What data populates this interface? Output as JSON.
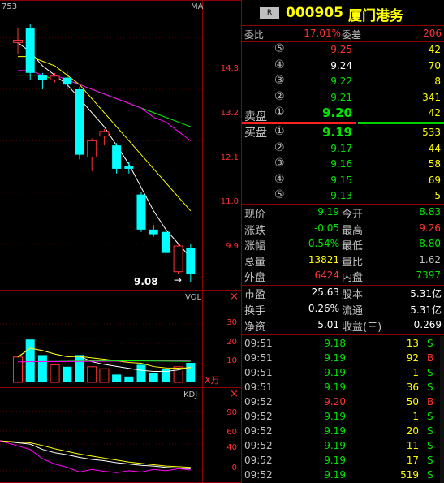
{
  "chart_panel": {
    "code_label": "753",
    "ma_label": "MA",
    "price_axis": [
      "14.3",
      "13.2",
      "12.1",
      "11.0",
      "9.9"
    ],
    "low_marker": "9.08",
    "vol_label": "VOL",
    "vol_axis": [
      "30",
      "20",
      "10"
    ],
    "vol_unit": "X万",
    "kdj_label": "KDJ",
    "kdj_axis": [
      "90",
      "60",
      "40",
      "20",
      "0"
    ]
  },
  "chart_data": {
    "type": "candlestick",
    "price_range": [
      9.0,
      14.9
    ],
    "candles": [
      {
        "o": 14.2,
        "c": 14.25,
        "h": 14.5,
        "l": 13.95,
        "color": "red"
      },
      {
        "o": 14.5,
        "c": 13.55,
        "h": 14.6,
        "l": 13.4,
        "color": "cyan"
      },
      {
        "o": 13.5,
        "c": 13.4,
        "h": 13.55,
        "l": 13.2,
        "color": "cyan"
      },
      {
        "o": 13.4,
        "c": 13.48,
        "h": 13.55,
        "l": 13.35,
        "color": "red"
      },
      {
        "o": 13.45,
        "c": 13.3,
        "h": 13.6,
        "l": 13.2,
        "color": "cyan"
      },
      {
        "o": 13.2,
        "c": 11.8,
        "h": 13.25,
        "l": 11.7,
        "color": "cyan"
      },
      {
        "o": 11.75,
        "c": 12.1,
        "h": 12.15,
        "l": 11.45,
        "color": "red"
      },
      {
        "o": 12.2,
        "c": 12.3,
        "h": 12.35,
        "l": 12.0,
        "color": "red"
      },
      {
        "o": 12.0,
        "c": 11.5,
        "h": 12.05,
        "l": 11.4,
        "color": "cyan"
      },
      {
        "o": 11.55,
        "c": 11.5,
        "h": 11.65,
        "l": 11.4,
        "color": "cyan"
      },
      {
        "o": 10.95,
        "c": 10.2,
        "h": 11.0,
        "l": 10.15,
        "color": "cyan"
      },
      {
        "o": 10.2,
        "c": 10.1,
        "h": 10.3,
        "l": 10.05,
        "color": "cyan"
      },
      {
        "o": 10.15,
        "c": 9.7,
        "h": 10.25,
        "l": 9.65,
        "color": "cyan"
      },
      {
        "o": 9.3,
        "c": 9.85,
        "h": 9.9,
        "l": 9.25,
        "color": "red"
      },
      {
        "o": 9.8,
        "c": 9.25,
        "h": 9.9,
        "l": 9.08,
        "color": "cyan"
      }
    ],
    "ma_series": [
      {
        "color": "#ffffff",
        "values": [
          14.2,
          14.0,
          13.7,
          13.5,
          13.3,
          13.0,
          12.7,
          12.4,
          12.0,
          11.6,
          11.1,
          10.6,
          10.2,
          9.9,
          9.6
        ]
      },
      {
        "color": "#ffff00",
        "values": [
          13.9,
          13.9,
          13.8,
          13.7,
          13.5,
          13.3,
          13.0,
          12.7,
          12.4,
          12.1,
          11.8,
          11.5,
          11.2,
          10.9,
          10.6
        ]
      },
      {
        "color": "#00ff00",
        "values": [
          13.5,
          13.5,
          13.5,
          13.4,
          13.4,
          13.3,
          13.2,
          13.1,
          13.0,
          12.9,
          12.8,
          12.7,
          12.6,
          12.5,
          12.4
        ]
      },
      {
        "color": "#ff00ff",
        "values": [
          13.6,
          13.6,
          13.5,
          13.5,
          13.4,
          13.3,
          13.2,
          13.1,
          13.0,
          12.9,
          12.8,
          12.6,
          12.5,
          12.3,
          12.1
        ]
      }
    ],
    "volumes": [
      {
        "v": 13,
        "color": "red"
      },
      {
        "v": 22,
        "color": "cyan"
      },
      {
        "v": 14,
        "color": "cyan"
      },
      {
        "v": 9,
        "color": "red"
      },
      {
        "v": 8,
        "color": "cyan"
      },
      {
        "v": 14,
        "color": "cyan"
      },
      {
        "v": 8,
        "color": "red"
      },
      {
        "v": 7,
        "color": "red"
      },
      {
        "v": 4,
        "color": "cyan"
      },
      {
        "v": 3,
        "color": "cyan"
      },
      {
        "v": 9,
        "color": "cyan"
      },
      {
        "v": 5,
        "color": "cyan"
      },
      {
        "v": 7,
        "color": "cyan"
      },
      {
        "v": 8,
        "color": "red"
      },
      {
        "v": 10,
        "color": "cyan"
      }
    ],
    "vol_range": [
      0,
      40
    ],
    "kdj_range": [
      -10,
      110
    ],
    "kdj_series": [
      {
        "color": "#ffffff",
        "values": [
          45,
          40,
          32,
          27,
          24,
          20,
          17,
          15,
          12,
          10,
          8,
          7,
          5,
          4,
          3
        ]
      },
      {
        "color": "#ffff00",
        "values": [
          45,
          42,
          38,
          33,
          29,
          25,
          22,
          19,
          16,
          13,
          11,
          9,
          7,
          6,
          5
        ]
      },
      {
        "color": "#ff00ff",
        "values": [
          45,
          32,
          18,
          10,
          5,
          -2,
          2,
          -1,
          -3,
          0,
          -2,
          2,
          0,
          3,
          1
        ]
      }
    ]
  },
  "header": {
    "badge": "R",
    "code": "000905",
    "name": "厦门港务"
  },
  "weibi": {
    "label": "委比",
    "value": "17.01%",
    "label2": "委差",
    "value2": "206"
  },
  "asks": [
    {
      "idx": "⑤",
      "price": "9.25",
      "vol": "42",
      "pc": "red"
    },
    {
      "idx": "④",
      "price": "9.24",
      "vol": "70",
      "pc": "white"
    },
    {
      "idx": "③",
      "price": "9.22",
      "vol": "8",
      "pc": "green"
    },
    {
      "idx": "②",
      "price": "9.21",
      "vol": "341",
      "pc": "green"
    },
    {
      "idx": "①",
      "price": "9.20",
      "vol": "42",
      "pc": "green"
    }
  ],
  "ask_label": "卖盘",
  "bid_label": "买盘",
  "bids": [
    {
      "idx": "①",
      "price": "9.19",
      "vol": "533"
    },
    {
      "idx": "②",
      "price": "9.17",
      "vol": "44"
    },
    {
      "idx": "③",
      "price": "9.16",
      "vol": "58"
    },
    {
      "idx": "④",
      "price": "9.15",
      "vol": "69"
    },
    {
      "idx": "⑤",
      "price": "9.13",
      "vol": "5"
    }
  ],
  "quote": [
    {
      "l1": "现价",
      "v1": "9.19",
      "c1": "green",
      "l2": "今开",
      "v2": "8.83",
      "c2": "green"
    },
    {
      "l1": "涨跌",
      "v1": "-0.05",
      "c1": "green",
      "l2": "最高",
      "v2": "9.26",
      "c2": "red"
    },
    {
      "l1": "涨幅",
      "v1": "-0.54%",
      "c1": "green",
      "l2": "最低",
      "v2": "8.80",
      "c2": "green"
    },
    {
      "l1": "总量",
      "v1": "13821",
      "c1": "yellow",
      "l2": "量比",
      "v2": "1.62",
      "c2": "gray"
    },
    {
      "l1": "外盘",
      "v1": "6424",
      "c1": "red",
      "l2": "内盘",
      "v2": "7397",
      "c2": "green"
    }
  ],
  "fund": [
    {
      "l1": "市盈",
      "v1": "25.63",
      "l2": "股本",
      "v2": "5.31亿"
    },
    {
      "l1": "换手",
      "v1": "0.26%",
      "l2": "流通",
      "v2": "5.31亿"
    },
    {
      "l1": "净资",
      "v1": "5.01",
      "l2": "收益(三)",
      "v2": "0.269"
    }
  ],
  "ticks": [
    {
      "time": "09:51",
      "price": "9.18",
      "vol": "13",
      "side": "S"
    },
    {
      "time": "09:51",
      "price": "9.19",
      "vol": "92",
      "side": "B"
    },
    {
      "time": "09:51",
      "price": "9.19",
      "vol": "1",
      "side": "S"
    },
    {
      "time": "09:51",
      "price": "9.19",
      "vol": "36",
      "side": "S"
    },
    {
      "time": "09:52",
      "price": "9.20",
      "vol": "50",
      "side": "B"
    },
    {
      "time": "09:52",
      "price": "9.19",
      "vol": "1",
      "side": "S"
    },
    {
      "time": "09:52",
      "price": "9.19",
      "vol": "20",
      "side": "S"
    },
    {
      "time": "09:52",
      "price": "9.19",
      "vol": "11",
      "side": "S"
    },
    {
      "time": "09:52",
      "price": "9.19",
      "vol": "17",
      "side": "S"
    },
    {
      "time": "09:52",
      "price": "9.19",
      "vol": "519",
      "side": "S"
    }
  ]
}
